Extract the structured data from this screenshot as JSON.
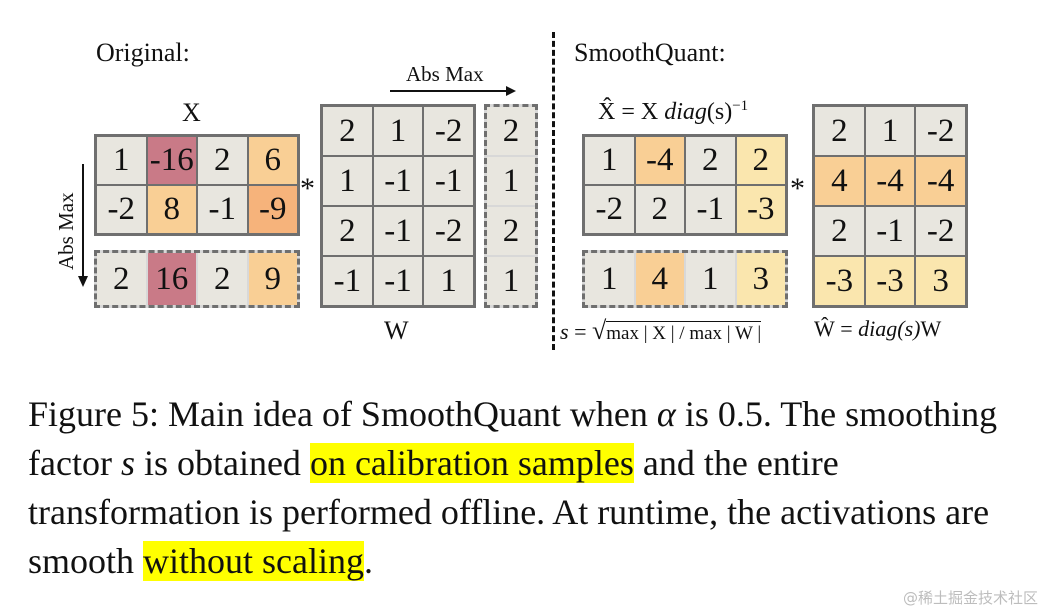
{
  "figure": {
    "original_label": "Original:",
    "smooth_label": "SmoothQuant:",
    "x_label": "X",
    "w_label": "W",
    "abs_max_top": "Abs Max",
    "abs_max_side": "Abs Max",
    "star": "*",
    "xhat_eq_lhs": "X̂ = X ",
    "xhat_eq_diag": "diag",
    "xhat_eq_s": "(s)",
    "xhat_eq_exp": "−1",
    "s_eq_lhs": "s",
    "s_eq_eq": " = ",
    "s_eq_rad": "max | X | / max | W |",
    "what_eq_lhs": "Ŵ = ",
    "what_eq_diag": "diag",
    "what_eq_rest": "(s)W",
    "matrices": {
      "x_original": [
        [
          "1",
          "-16",
          "2",
          "6"
        ],
        [
          "-2",
          "8",
          "-1",
          "-9"
        ]
      ],
      "x_absmax": [
        "2",
        "16",
        "2",
        "9"
      ],
      "w_original": [
        [
          "2",
          "1",
          "-2"
        ],
        [
          "1",
          "-1",
          "-1"
        ],
        [
          "2",
          "-1",
          "-2"
        ],
        [
          "-1",
          "-1",
          "1"
        ]
      ],
      "w_absmax": [
        "2",
        "1",
        "2",
        "1"
      ],
      "x_smooth": [
        [
          "1",
          "-4",
          "2",
          "2"
        ],
        [
          "-2",
          "2",
          "-1",
          "-3"
        ]
      ],
      "x_smooth_absmax": [
        "1",
        "4",
        "1",
        "3"
      ],
      "w_smooth": [
        [
          "2",
          "1",
          "-2"
        ],
        [
          "4",
          "-4",
          "-4"
        ],
        [
          "2",
          "-1",
          "-2"
        ],
        [
          "-3",
          "-3",
          "3"
        ]
      ]
    },
    "colors": {
      "x_original": [
        [
          "gray",
          "rose",
          "gray",
          "orange"
        ],
        [
          "gray",
          "orange",
          "gray",
          "orange2"
        ]
      ],
      "x_absmax": [
        "gray",
        "rose",
        "gray",
        "orange"
      ],
      "w_original": [
        [
          "gray",
          "gray",
          "gray"
        ],
        [
          "gray",
          "gray",
          "gray"
        ],
        [
          "gray",
          "gray",
          "gray"
        ],
        [
          "gray",
          "gray",
          "gray"
        ]
      ],
      "w_absmax": [
        "gray",
        "gray",
        "gray",
        "gray"
      ],
      "x_smooth": [
        [
          "gray",
          "orange",
          "gray",
          "yellow"
        ],
        [
          "gray",
          "gray",
          "gray",
          "yellow"
        ]
      ],
      "x_smooth_absmax": [
        "gray",
        "orange",
        "gray",
        "yellow"
      ],
      "w_smooth": [
        [
          "gray",
          "gray",
          "gray"
        ],
        [
          "orange",
          "orange",
          "orange"
        ],
        [
          "gray",
          "gray",
          "gray"
        ],
        [
          "yellow",
          "yellow",
          "yellow"
        ]
      ]
    }
  },
  "caption": {
    "p1": "Figure 5: Main idea of SmoothQuant when ",
    "alpha": "α",
    "p2": " is 0.5. The smoothing factor ",
    "s": "s",
    "p3": " is obtained ",
    "hl1": "on calibration samples",
    "p4": " and the entire transformation is performed offline. At runtime, the activations are smooth ",
    "hl2": "without scaling",
    "p5": "."
  },
  "watermark": "@稀土掘金技术社区"
}
